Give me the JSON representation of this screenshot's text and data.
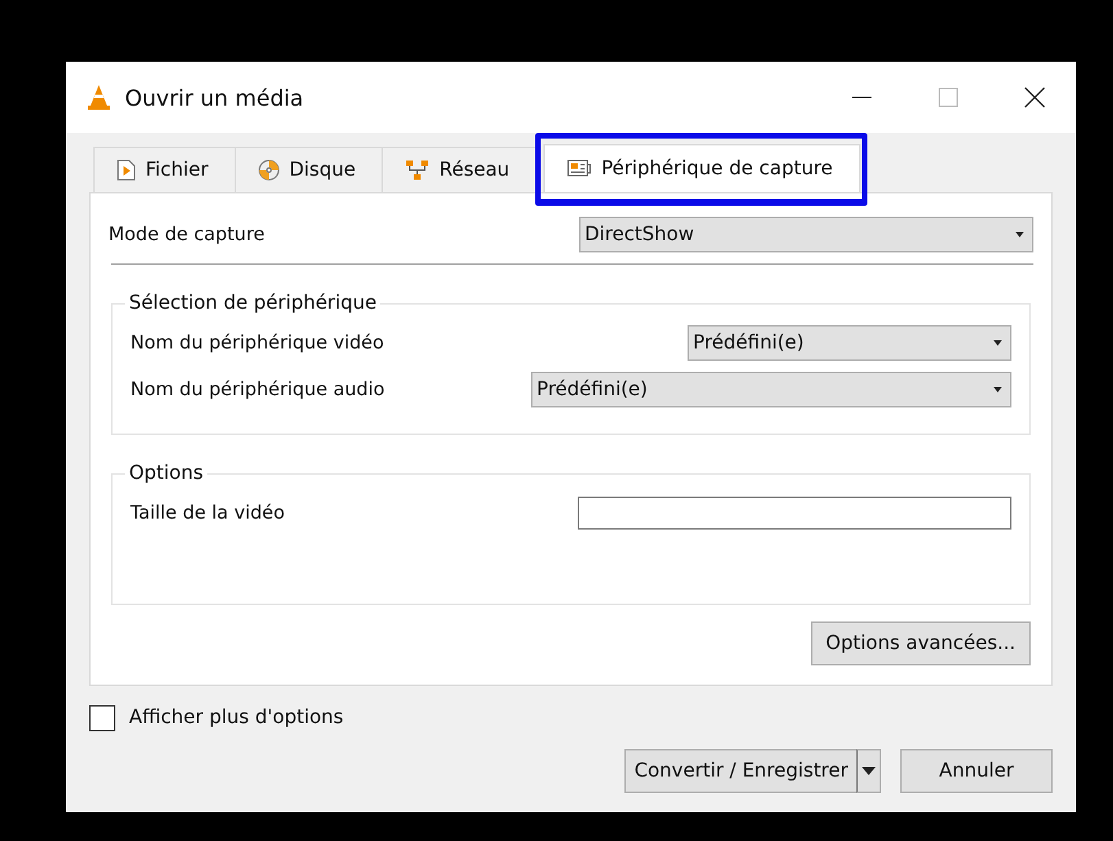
{
  "window": {
    "title": "Ouvrir un média"
  },
  "tabs": [
    {
      "label": "Fichier",
      "selected": false,
      "highlighted": false
    },
    {
      "label": "Disque",
      "selected": false,
      "highlighted": false
    },
    {
      "label": "Réseau",
      "selected": false,
      "highlighted": false
    },
    {
      "label": "Périphérique de capture",
      "selected": true,
      "highlighted": true
    }
  ],
  "capture_mode": {
    "label": "Mode de capture",
    "value": "DirectShow"
  },
  "device_selection": {
    "title": "Sélection de périphérique",
    "rows": [
      {
        "label": "Nom du périphérique vidéo",
        "value": "Prédéfini(e)"
      },
      {
        "label": "Nom du périphérique audio",
        "value": "Prédéfini(e)"
      }
    ]
  },
  "options": {
    "title": "Options",
    "video_size": {
      "label": "Taille de la vidéo"
    }
  },
  "advanced_button": "Options avancées...",
  "more_options": {
    "label": "Afficher plus d'options",
    "checked": false
  },
  "buttons": {
    "convert": "Convertir / Enregistrer",
    "cancel": "Annuler"
  }
}
